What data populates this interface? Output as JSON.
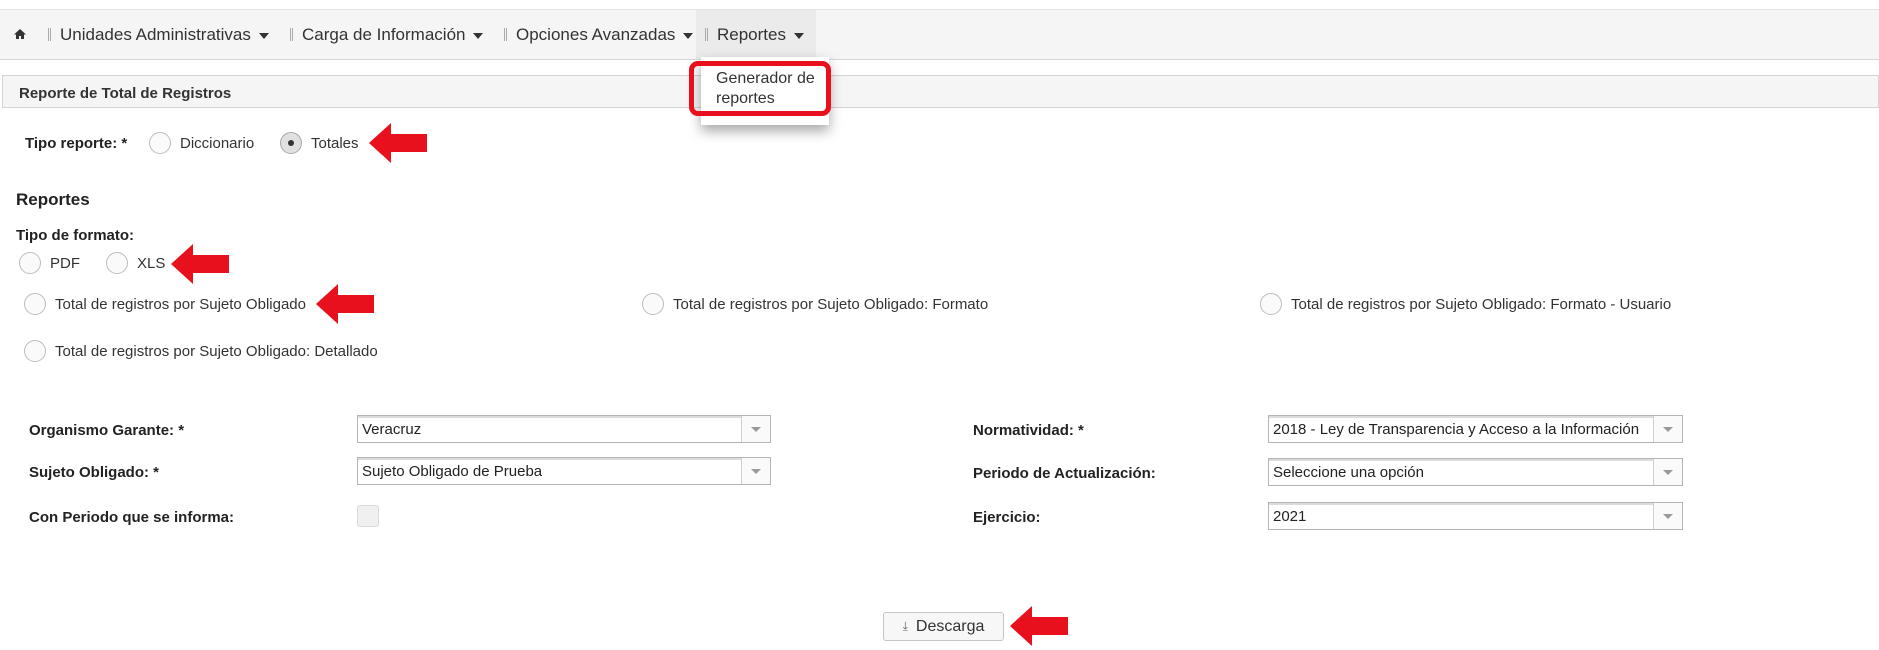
{
  "nav": {
    "home_icon": "home-icon",
    "items": [
      {
        "label": "Unidades Administrativas"
      },
      {
        "label": "Carga de Información"
      },
      {
        "label": "Opciones Avanzadas"
      },
      {
        "label": "Reportes"
      }
    ],
    "dropdown": {
      "item": "Generador de reportes"
    }
  },
  "panel": {
    "title": "Reporte de Total de Registros"
  },
  "tipo_reporte": {
    "label": "Tipo reporte: *",
    "options": [
      {
        "label": "Diccionario",
        "checked": false
      },
      {
        "label": "Totales",
        "checked": true
      }
    ]
  },
  "reportes": {
    "heading": "Reportes",
    "tipo_formato_label": "Tipo de formato:",
    "formats": [
      {
        "label": "PDF",
        "checked": false
      },
      {
        "label": "XLS",
        "checked": false
      }
    ],
    "report_options": [
      {
        "label": "Total de registros por Sujeto Obligado"
      },
      {
        "label": "Total de registros por Sujeto Obligado: Formato"
      },
      {
        "label": "Total de registros por Sujeto Obligado: Formato - Usuario"
      },
      {
        "label": "Total de registros por Sujeto Obligado: Detallado"
      }
    ]
  },
  "form": {
    "organismo": {
      "label": "Organismo Garante: *",
      "value": "Veracruz"
    },
    "sujeto": {
      "label": "Sujeto Obligado: *",
      "value": "Sujeto Obligado de Prueba"
    },
    "periodo_informa": {
      "label": "Con Periodo que se informa:",
      "checked": false
    },
    "normatividad": {
      "label": "Normatividad:  *",
      "value": "2018 - Ley de Transparencia y Acceso a la Información"
    },
    "periodo_actualizacion": {
      "label": "Periodo de Actualización:",
      "value": "Seleccione una opción"
    },
    "ejercicio": {
      "label": "Ejercicio:",
      "value": "2021"
    }
  },
  "download": {
    "label": "Descarga",
    "icon": "download-icon"
  },
  "colors": {
    "accent_red": "#e8101c"
  }
}
